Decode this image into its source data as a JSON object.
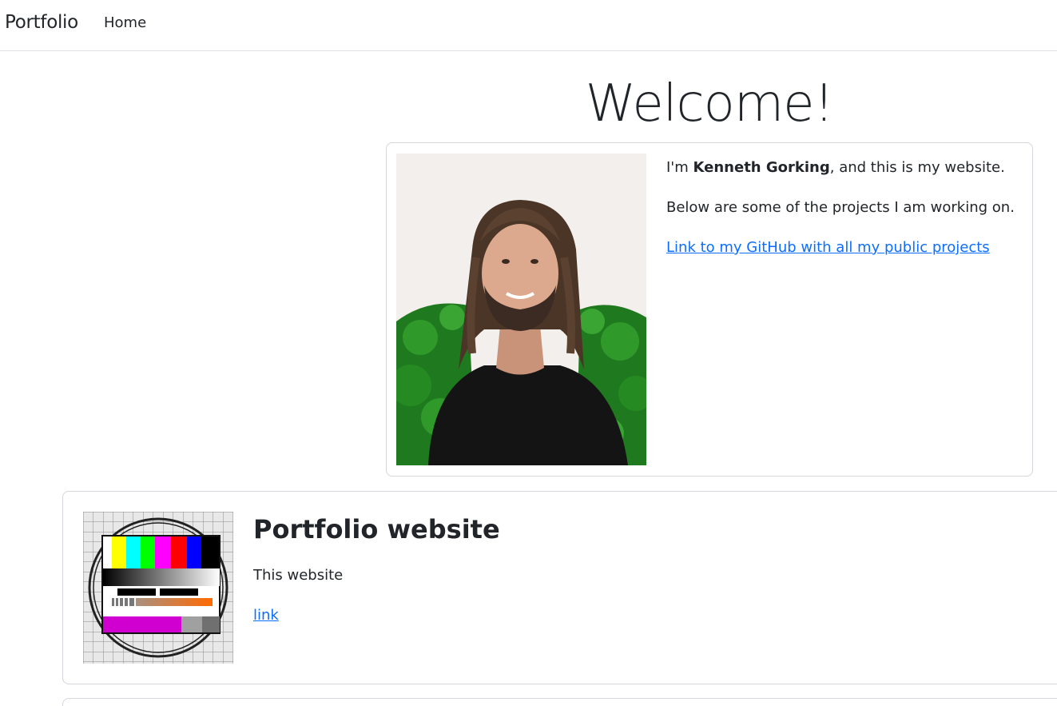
{
  "navbar": {
    "brand": "Portfolio",
    "home_label": "Home"
  },
  "main": {
    "welcome_heading": "Welcome!",
    "intro": {
      "line1_prefix": "I'm ",
      "line1_name": "Kenneth Gorking",
      "line1_suffix": ", and this is my website.",
      "line2": "Below are some of the projects I am working on.",
      "github_link_text": "Link to my GitHub with all my public projects"
    },
    "projects": [
      {
        "title": "Portfolio website",
        "description": "This website",
        "link_text": "link"
      }
    ]
  },
  "colors": {
    "link": "#0d6efd",
    "text": "#212529",
    "border": "#d3d6da"
  },
  "icons": {
    "portrait": "profile-photo",
    "project_thumbnail": "tv-test-pattern-icon"
  }
}
